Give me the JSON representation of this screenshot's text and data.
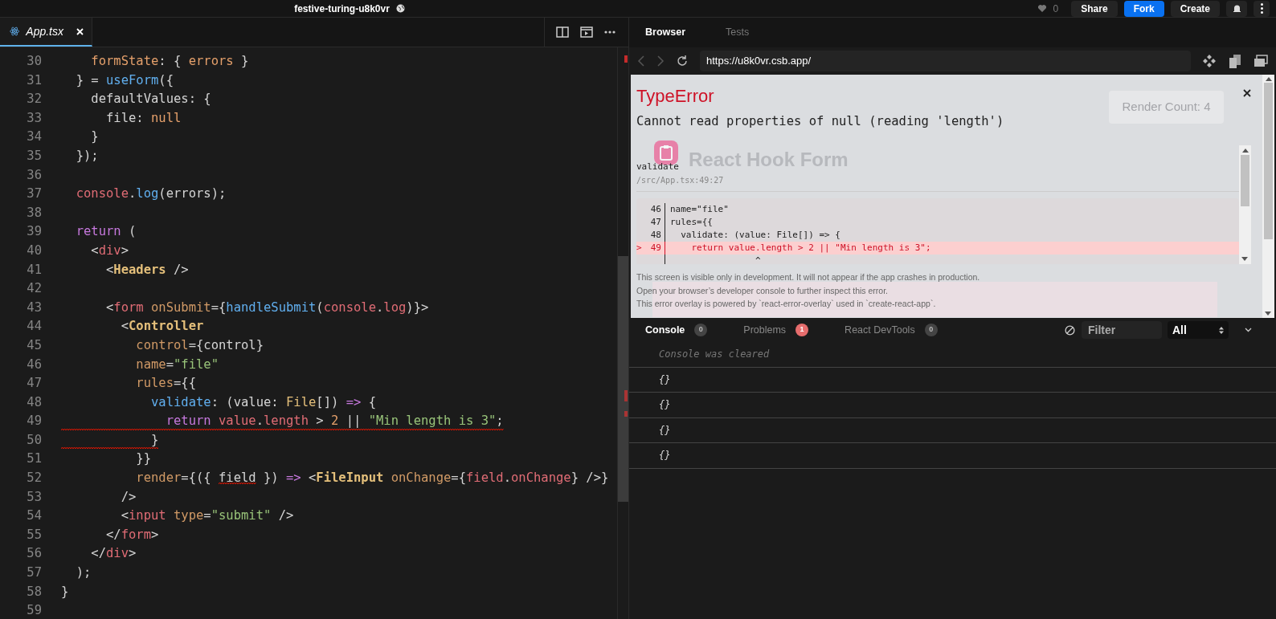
{
  "top_bar": {
    "project_title": "festive-turing-u8k0vr",
    "likes": "0",
    "buttons": [
      {
        "label": "Share",
        "kind": "plain"
      },
      {
        "label": "Fork",
        "kind": "primary"
      },
      {
        "label": "Create",
        "kind": "plain"
      }
    ]
  },
  "editor": {
    "tabs": [
      {
        "label": "App.tsx",
        "selected": true
      }
    ],
    "lines": [
      {
        "number": "30",
        "squiggle": false,
        "tokens": [
          {
            "text": "    formState",
            "kind": "property"
          },
          {
            "text": ": { ",
            "kind": "plain"
          },
          {
            "text": "errors",
            "kind": "property"
          },
          {
            "text": " }",
            "kind": "plain"
          }
        ]
      },
      {
        "number": "31",
        "squiggle": false,
        "tokens": [
          {
            "text": "  } = ",
            "kind": "plain"
          },
          {
            "text": "useForm",
            "kind": "function"
          },
          {
            "text": "({",
            "kind": "plain"
          }
        ]
      },
      {
        "number": "32",
        "squiggle": false,
        "tokens": [
          {
            "text": "    defaultValues: {",
            "kind": "plain"
          }
        ]
      },
      {
        "number": "33",
        "squiggle": false,
        "tokens": [
          {
            "text": "      file: ",
            "kind": "plain"
          },
          {
            "text": "null",
            "kind": "property"
          }
        ]
      },
      {
        "number": "34",
        "squiggle": false,
        "tokens": [
          {
            "text": "    }",
            "kind": "plain"
          }
        ]
      },
      {
        "number": "35",
        "squiggle": false,
        "tokens": [
          {
            "text": "  });",
            "kind": "plain"
          }
        ]
      },
      {
        "number": "36",
        "squiggle": false
      },
      {
        "number": "37",
        "squiggle": false,
        "tokens": [
          {
            "text": "  console",
            "kind": "variable"
          },
          {
            "text": ".",
            "kind": "plain"
          },
          {
            "text": "log",
            "kind": "function"
          },
          {
            "text": "(errors);",
            "kind": "plain"
          }
        ]
      },
      {
        "number": "38",
        "squiggle": false
      },
      {
        "number": "39",
        "squiggle": false,
        "tokens": [
          {
            "text": "  return",
            "kind": "keyword"
          },
          {
            "text": " (",
            "kind": "plain"
          }
        ]
      },
      {
        "number": "40",
        "squiggle": false,
        "tokens": [
          {
            "text": "    <",
            "kind": "plain"
          },
          {
            "text": "div",
            "kind": "tag"
          },
          {
            "text": ">",
            "kind": "plain"
          }
        ]
      },
      {
        "number": "41",
        "squiggle": false,
        "tokens": [
          {
            "text": "      <",
            "kind": "plain"
          },
          {
            "text": "Headers",
            "kind": "component"
          },
          {
            "text": " />",
            "kind": "plain"
          }
        ]
      },
      {
        "number": "42",
        "squiggle": false
      },
      {
        "number": "43",
        "squiggle": false,
        "tokens": [
          {
            "text": "      <",
            "kind": "plain"
          },
          {
            "text": "form",
            "kind": "tag"
          },
          {
            "text": " onSubmit",
            "kind": "attr"
          },
          {
            "text": "={",
            "kind": "plain"
          },
          {
            "text": "handleSubmit",
            "kind": "function"
          },
          {
            "text": "(",
            "kind": "plain"
          },
          {
            "text": "console",
            "kind": "variable"
          },
          {
            "text": ".",
            "kind": "plain"
          },
          {
            "text": "log",
            "kind": "variable"
          },
          {
            "text": ")}>",
            "kind": "plain"
          }
        ]
      },
      {
        "number": "44",
        "squiggle": false,
        "tokens": [
          {
            "text": "        <",
            "kind": "plain"
          },
          {
            "text": "Controller",
            "kind": "component"
          }
        ]
      },
      {
        "number": "45",
        "squiggle": false,
        "tokens": [
          {
            "text": "          control",
            "kind": "attr"
          },
          {
            "text": "={control}",
            "kind": "plain"
          }
        ]
      },
      {
        "number": "46",
        "squiggle": false,
        "tokens": [
          {
            "text": "          name",
            "kind": "attr"
          },
          {
            "text": "=",
            "kind": "plain"
          },
          {
            "text": "\"file\"",
            "kind": "string"
          }
        ]
      },
      {
        "number": "47",
        "squiggle": false,
        "tokens": [
          {
            "text": "          rules",
            "kind": "attr"
          },
          {
            "text": "={{",
            "kind": "plain"
          }
        ]
      },
      {
        "number": "48",
        "squiggle": false,
        "tokens": [
          {
            "text": "            validate",
            "kind": "function"
          },
          {
            "text": ": (value: ",
            "kind": "plain"
          },
          {
            "text": "File",
            "kind": "type"
          },
          {
            "text": "[]) ",
            "kind": "plain"
          },
          {
            "text": "=>",
            "kind": "keyword"
          },
          {
            "text": " {",
            "kind": "plain"
          }
        ]
      },
      {
        "number": "49",
        "squiggle": true,
        "tokens": [
          {
            "text": "              return",
            "kind": "keyword"
          },
          {
            "text": " value",
            "kind": "variable"
          },
          {
            "text": ".",
            "kind": "plain"
          },
          {
            "text": "length",
            "kind": "variable"
          },
          {
            "text": " > ",
            "kind": "plain"
          },
          {
            "text": "2",
            "kind": "property"
          },
          {
            "text": " || ",
            "kind": "plain"
          },
          {
            "text": "\"Min length is 3\"",
            "kind": "string"
          },
          {
            "text": ";",
            "kind": "plain"
          }
        ]
      },
      {
        "number": "50",
        "squiggle": true,
        "tokens": [
          {
            "text": "            }",
            "kind": "plain"
          }
        ]
      },
      {
        "number": "51",
        "squiggle": false,
        "tokens": [
          {
            "text": "          }}",
            "kind": "plain"
          }
        ]
      },
      {
        "number": "52",
        "squiggle": false,
        "tokens": [
          {
            "text": "          render",
            "kind": "attr"
          },
          {
            "text": "={({ ",
            "kind": "plain"
          },
          {
            "text": "field",
            "kind": "plain",
            "error": true
          },
          {
            "text": " }) ",
            "kind": "plain"
          },
          {
            "text": "=>",
            "kind": "keyword"
          },
          {
            "text": " <",
            "kind": "plain"
          },
          {
            "text": "FileInput",
            "kind": "component"
          },
          {
            "text": " onChange",
            "kind": "attr"
          },
          {
            "text": "={",
            "kind": "plain"
          },
          {
            "text": "field",
            "kind": "variable"
          },
          {
            "text": ".",
            "kind": "plain"
          },
          {
            "text": "onChange",
            "kind": "variable"
          },
          {
            "text": "} />}",
            "kind": "plain"
          }
        ]
      },
      {
        "number": "53",
        "squiggle": false,
        "tokens": [
          {
            "text": "        />",
            "kind": "plain"
          }
        ]
      },
      {
        "number": "54",
        "squiggle": false,
        "tokens": [
          {
            "text": "        <",
            "kind": "plain"
          },
          {
            "text": "input",
            "kind": "tag"
          },
          {
            "text": " type",
            "kind": "attr"
          },
          {
            "text": "=",
            "kind": "plain"
          },
          {
            "text": "\"submit\"",
            "kind": "string"
          },
          {
            "text": " />",
            "kind": "plain"
          }
        ]
      },
      {
        "number": "55",
        "squiggle": false,
        "tokens": [
          {
            "text": "      </",
            "kind": "plain"
          },
          {
            "text": "form",
            "kind": "tag"
          },
          {
            "text": ">",
            "kind": "plain"
          }
        ]
      },
      {
        "number": "56",
        "squiggle": false,
        "tokens": [
          {
            "text": "    </",
            "kind": "plain"
          },
          {
            "text": "div",
            "kind": "tag"
          },
          {
            "text": ">",
            "kind": "plain"
          }
        ]
      },
      {
        "number": "57",
        "squiggle": false,
        "tokens": [
          {
            "text": "  );",
            "kind": "plain"
          }
        ]
      },
      {
        "number": "58",
        "squiggle": false,
        "tokens": [
          {
            "text": "}",
            "kind": "plain"
          }
        ]
      },
      {
        "number": "59",
        "squiggle": false
      }
    ]
  },
  "preview": {
    "tabs": [
      {
        "label": "Browser",
        "selected": true
      },
      {
        "label": "Tests",
        "selected": false
      }
    ],
    "url": "https://u8k0vr.csb.app/",
    "app": {
      "render_count": "Render Count: 4",
      "title": "React Hook Form"
    },
    "error_overlay": {
      "title": "TypeError",
      "message": "Cannot read properties of null (reading 'length')",
      "function": "validate",
      "location": "/src/App.tsx:49:27",
      "frame_lines": [
        {
          "number": "46",
          "code": "name=\"file\"",
          "highlighted": false
        },
        {
          "number": "47",
          "code": "rules={{",
          "highlighted": false
        },
        {
          "number": "48",
          "code": "  validate: (value: File[]) => {",
          "highlighted": false
        },
        {
          "marker": ">",
          "number": "49",
          "code": "    return value.length > 2 || \"Min length is 3\";",
          "highlighted": true
        },
        {
          "code": "                ^",
          "highlighted": false
        }
      ],
      "footer": [
        "This screen is visible only in development. It will not appear if the app crashes in production.",
        "Open your browser’s developer console to further inspect this error.",
        "This error overlay is powered by `react-error-overlay` used in `create-react-app`."
      ]
    }
  },
  "console": {
    "tabs": [
      {
        "label": "Console",
        "count": "0",
        "selected": true,
        "alert": false
      },
      {
        "label": "Problems",
        "count": "1",
        "selected": false,
        "alert": true
      },
      {
        "label": "React DevTools",
        "count": "0",
        "selected": false,
        "alert": false
      }
    ],
    "filter": {
      "placeholder": "Filter"
    },
    "level": "All",
    "entries": [
      {
        "text": "Console was cleared",
        "kind": "note"
      },
      {
        "text": "{}",
        "kind": "log"
      },
      {
        "text": "{}",
        "kind": "log"
      },
      {
        "text": "{}",
        "kind": "log"
      },
      {
        "text": "{}",
        "kind": "log"
      }
    ]
  }
}
